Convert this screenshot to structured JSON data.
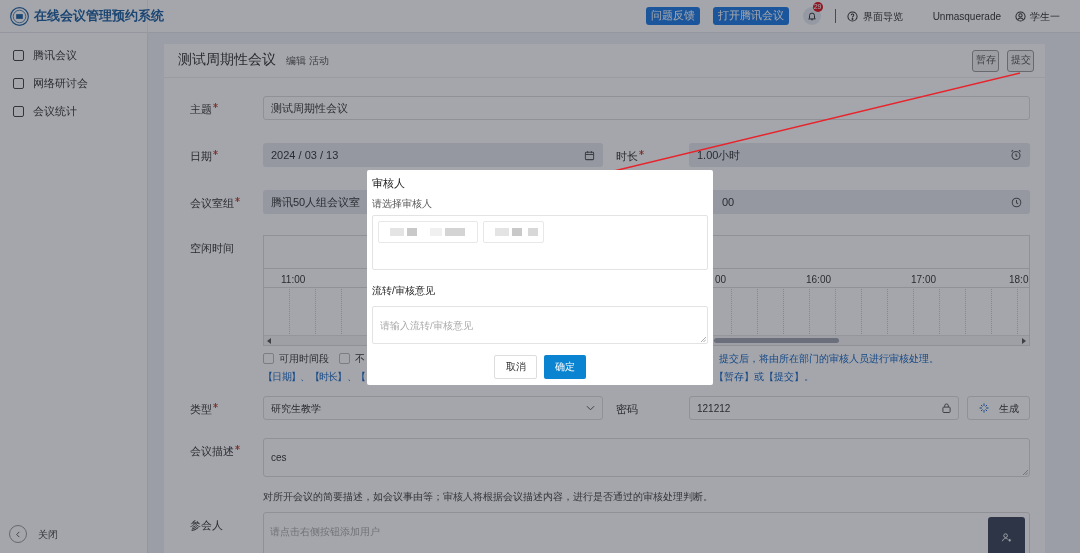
{
  "header": {
    "title": "在线会议管理预约系统",
    "buttons": [
      "问题反馈",
      "打开腾讯会议"
    ],
    "notification_count": "29",
    "guide": "界面导览",
    "account": "Unmasquerade",
    "user": "学生一"
  },
  "sidebar": {
    "items": [
      {
        "label": "腾讯会议"
      },
      {
        "label": "网络研讨会"
      },
      {
        "label": "会议统计"
      }
    ],
    "collapse": "关闭"
  },
  "page": {
    "title": "测试周期性会议",
    "subtitle": "编辑 活动",
    "actions": [
      "暂存",
      "提交"
    ]
  },
  "form": {
    "subject": {
      "label": "主题",
      "required": true,
      "value": "测试周期性会议"
    },
    "date": {
      "label": "日期",
      "required": true,
      "value": "2024 / 03 / 13"
    },
    "duration": {
      "label": "时长",
      "required": true,
      "value": "1.00小时"
    },
    "room": {
      "label": "会议室组",
      "required": true,
      "value": "腾讯50人组会议室",
      "time_fragment": "00"
    },
    "free_time": {
      "label": "空闲时间",
      "hours": [
        "11:00",
        "00",
        "16:00",
        "17:00",
        "18:0"
      ],
      "legend": [
        {
          "label": "可用时间段",
          "checked": false
        },
        {
          "label": "不",
          "checked": false
        }
      ],
      "notice_1": "提交后，将由所在部门的审核人员进行审核处理。",
      "notice_2a": "【日期】、【时长】、【",
      "notice_2b": "【暂存】或【提交】。"
    },
    "type": {
      "label": "类型",
      "required": true,
      "value": "研究生教学"
    },
    "password": {
      "label": "密码",
      "required": false,
      "value": "121212"
    },
    "generate": "生成",
    "description": {
      "label": "会议描述",
      "required": true,
      "value": "ces",
      "hint": "对所开会议的简要描述，如会议事由等；审核人将根据会议描述内容，进行是否通过的审核处理判断。"
    },
    "attendees": {
      "label": "参会人",
      "placeholder": "请点击右侧按钮添加用户"
    }
  },
  "dialog": {
    "reviewer_label": "审核人",
    "reviewer_hint": "请选择审核人",
    "reviewers": [
      {
        "kind": "redacted"
      },
      {
        "kind": "redacted"
      }
    ],
    "opinion_label": "流转/审核意见",
    "opinion_placeholder": "请输入流转/审核意见",
    "cancel": "取消",
    "confirm": "确定"
  }
}
